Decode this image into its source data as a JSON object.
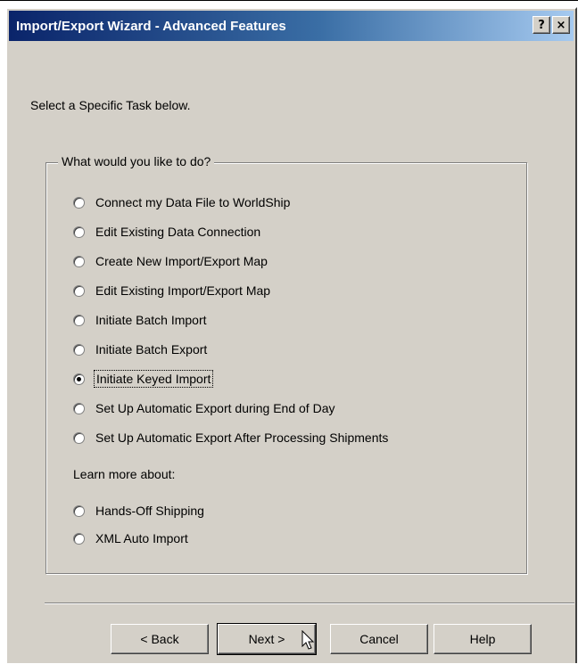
{
  "window": {
    "title": "Import/Export Wizard - Advanced Features",
    "help_btn": "?",
    "close_btn": "×"
  },
  "instruction": "Select a Specific Task below.",
  "group": {
    "legend": "What would you like to do?",
    "options": [
      {
        "label": "Connect my Data File to WorldShip",
        "checked": false
      },
      {
        "label": "Edit Existing Data Connection",
        "checked": false
      },
      {
        "label": "Create New Import/Export Map",
        "checked": false
      },
      {
        "label": "Edit Existing Import/Export Map",
        "checked": false
      },
      {
        "label": "Initiate Batch Import",
        "checked": false
      },
      {
        "label": "Initiate Batch Export",
        "checked": false
      },
      {
        "label": "Initiate Keyed Import",
        "checked": true
      },
      {
        "label": "Set Up Automatic Export during End of Day",
        "checked": false
      },
      {
        "label": "Set Up Automatic Export After Processing Shipments",
        "checked": false
      }
    ],
    "learn_more": "Learn more about:",
    "learn_options": [
      {
        "label": "Hands-Off Shipping",
        "checked": false
      },
      {
        "label": "XML Auto Import",
        "checked": false
      }
    ]
  },
  "buttons": {
    "back": "< Back",
    "next": "Next >",
    "cancel": "Cancel",
    "help": "Help"
  }
}
